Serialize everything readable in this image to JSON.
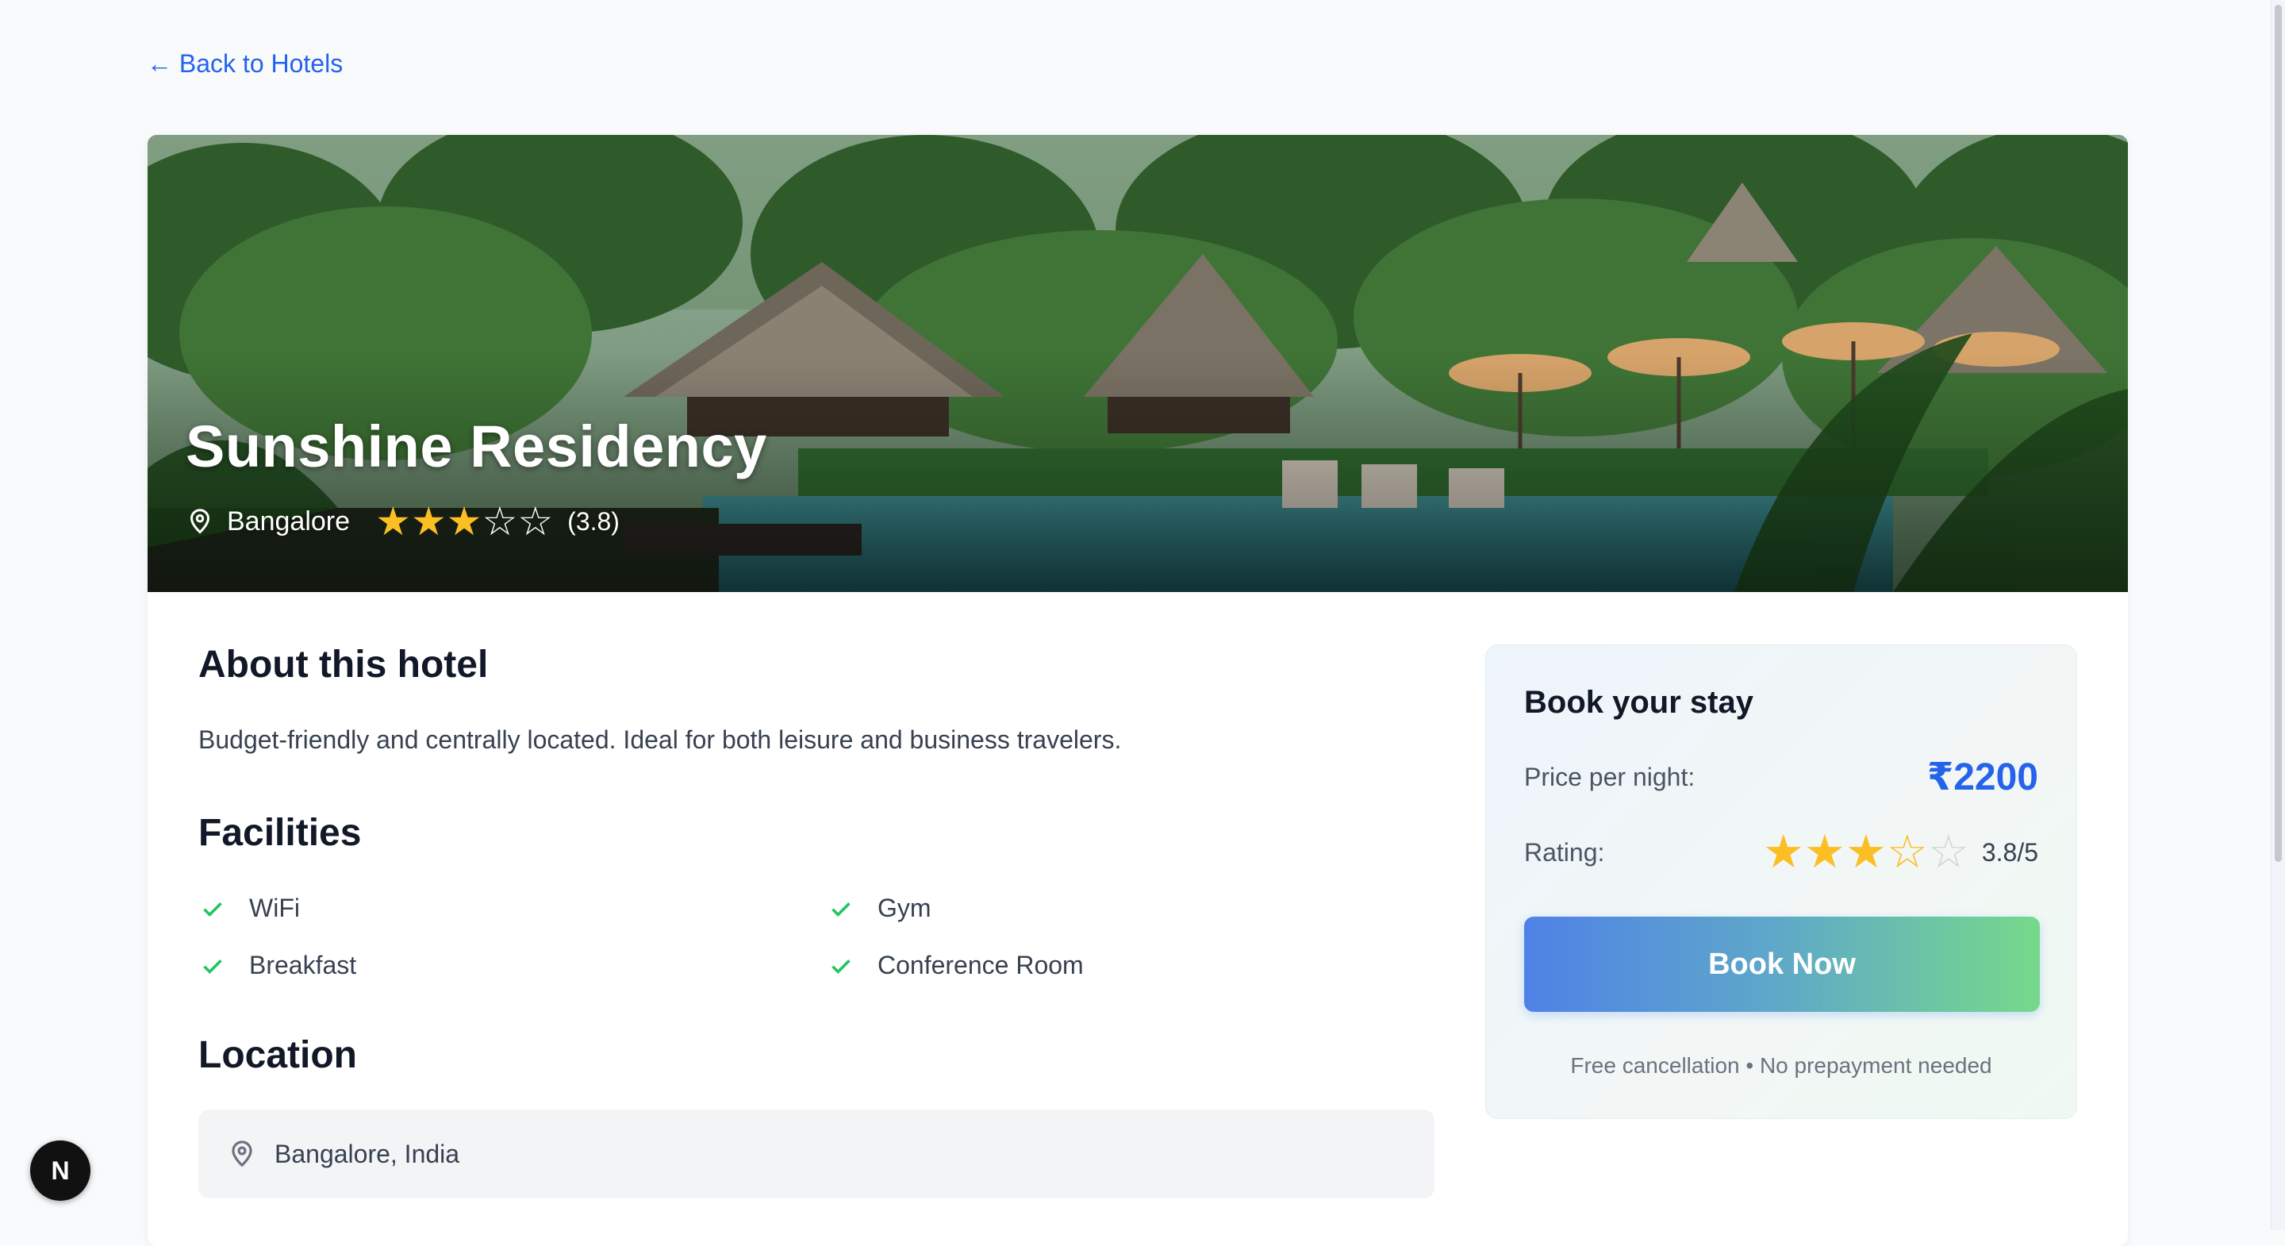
{
  "nav": {
    "back_label": "← Back to Hotels"
  },
  "hotel": {
    "name": "Sunshine Residency",
    "city": "Bangalore",
    "rating_text": "(3.8)",
    "rating": 3.8
  },
  "about": {
    "title": "About this hotel",
    "description": "Budget-friendly and centrally located. Ideal for both leisure and business travelers."
  },
  "facilities": {
    "title": "Facilities",
    "items": [
      "WiFi",
      "Gym",
      "Breakfast",
      "Conference Room"
    ]
  },
  "location": {
    "title": "Location",
    "address": "Bangalore, India"
  },
  "booking": {
    "title": "Book your stay",
    "price_label": "Price per night:",
    "price": "₹2200",
    "rating_label": "Rating:",
    "rating_value": "3.8/5",
    "button_label": "Book Now",
    "note": "Free cancellation • No prepayment needed"
  },
  "dev_badge": {
    "letter": "N"
  },
  "colors": {
    "accent": "#2563eb",
    "star": "#fbbf24",
    "check": "#22c55e",
    "button_gradient_start": "#4f82e6",
    "button_gradient_end": "#76d98a"
  },
  "icons": [
    "map-pin-icon",
    "star-icon",
    "check-icon",
    "nextjs-icon"
  ]
}
